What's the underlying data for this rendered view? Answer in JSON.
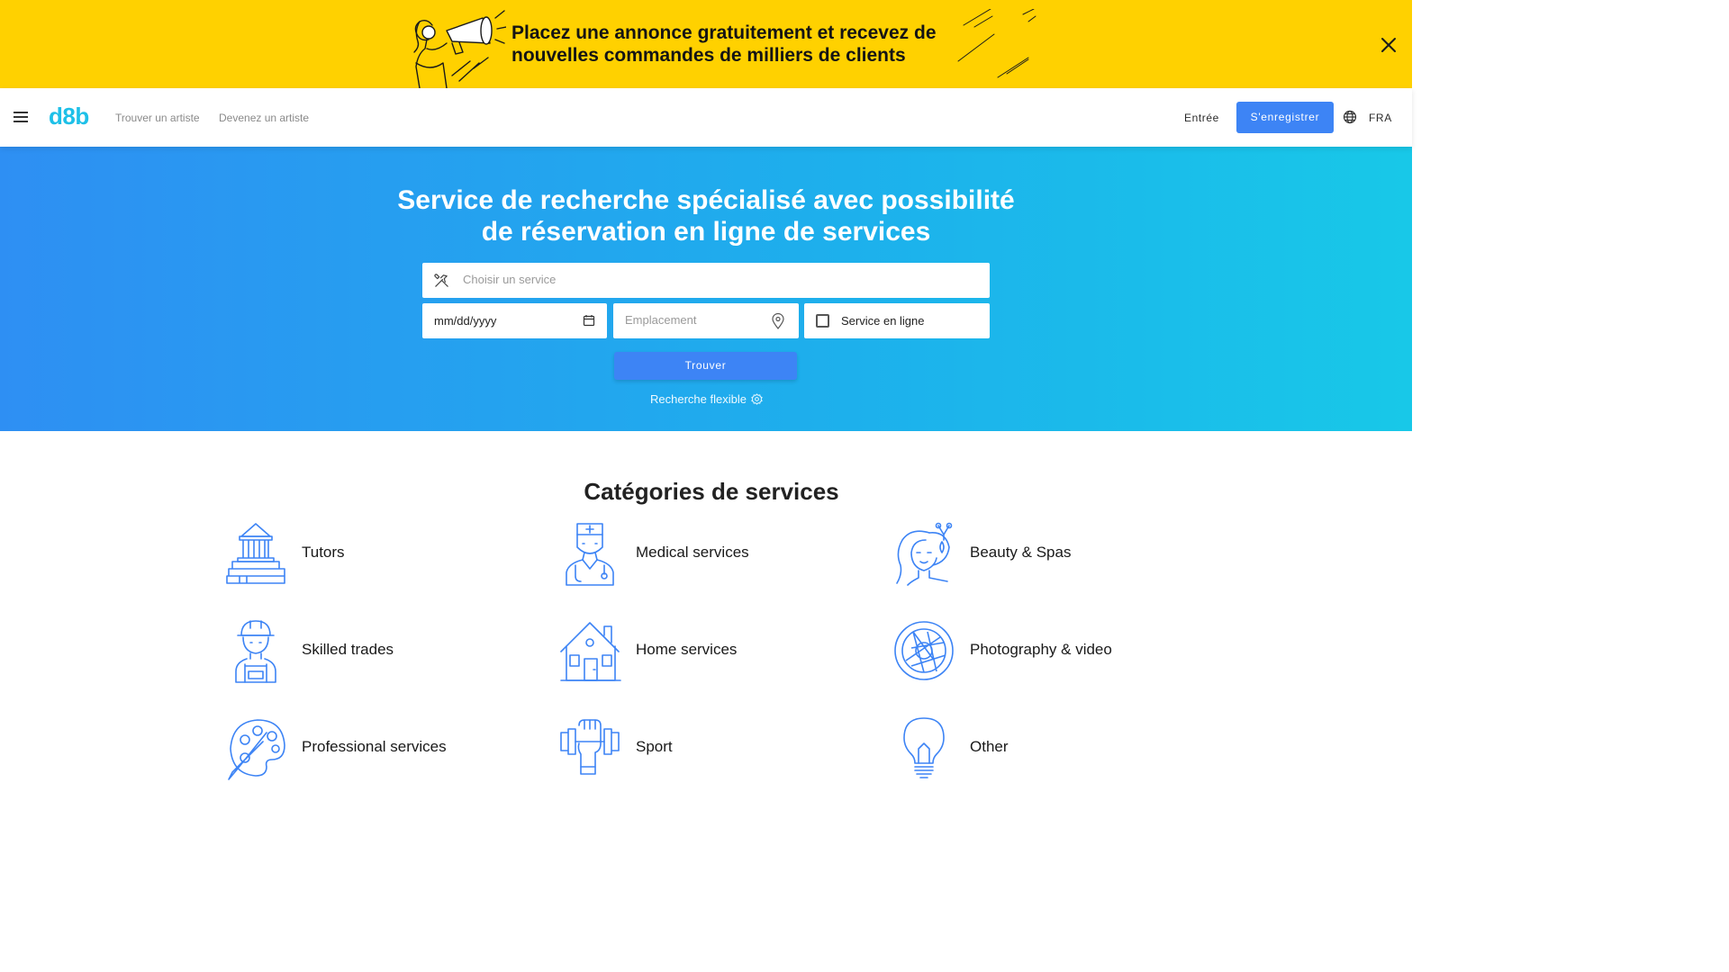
{
  "promo": {
    "text_line1": "Placez une annonce gratuitement et recevez de",
    "text_line2": "nouvelles commandes de milliers de clients",
    "close_icon": "close-icon",
    "background": "#ffd100"
  },
  "nav": {
    "logo": "d8b",
    "links": [
      "Trouver un artiste",
      "Devenez un artiste"
    ],
    "login": "Entrée",
    "register": "S'enregistrer",
    "language": "FRA",
    "accent": "#3d84f5"
  },
  "hero": {
    "title_line1": "Service de recherche spécialisé avec possibilité",
    "title_line2": "de réservation en ligne de services",
    "service_placeholder": "Choisir un service",
    "date_value": "mm/dd/yyyy",
    "location_placeholder": "Emplacement",
    "online_label": "Service en ligne",
    "online_checked": false,
    "find_button": "Trouver",
    "flexible_search": "Recherche flexible"
  },
  "categories": {
    "title": "Catégories de services",
    "items": [
      {
        "label": "Tutors",
        "icon": "library-icon"
      },
      {
        "label": "Medical services",
        "icon": "nurse-icon"
      },
      {
        "label": "Beauty & Spas",
        "icon": "beauty-icon"
      },
      {
        "label": "Skilled trades",
        "icon": "worker-icon"
      },
      {
        "label": "Home services",
        "icon": "house-icon"
      },
      {
        "label": "Photography & video",
        "icon": "aperture-icon"
      },
      {
        "label": "Professional services",
        "icon": "palette-icon"
      },
      {
        "label": "Sport",
        "icon": "dumbbell-icon"
      },
      {
        "label": "Other",
        "icon": "lightbulb-icon"
      }
    ]
  }
}
